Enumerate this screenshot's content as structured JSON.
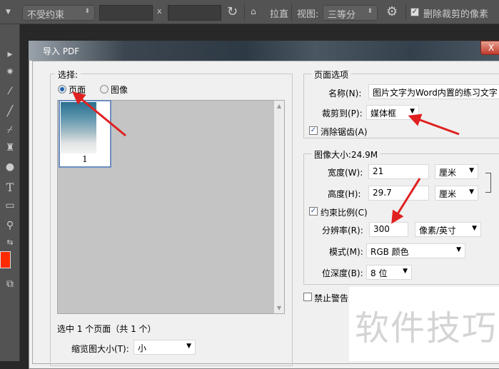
{
  "toolbar": {
    "constraint": "不受约束",
    "x_sep": "x",
    "straighten": "拉直",
    "view_label": "视图:",
    "view_value": "三等分",
    "delete_cropped": "删除裁剪的像素",
    "delete_cropped_checked": true
  },
  "dialog": {
    "title": "导入 PDF",
    "close": "X",
    "select_group": {
      "label": "选择:",
      "radio_page": "页面",
      "radio_image": "图像",
      "selected": "页面",
      "thumbnail_page_num": "1",
      "status": "选中 1 个页面（共 1 个）",
      "thumb_size_label": "缩览图大小(T):",
      "thumb_size_value": "小"
    },
    "page_options": {
      "label": "页面选项",
      "name_label": "名称(N):",
      "name_value": "图片文字为Word内置的练习文字",
      "crop_label": "裁剪到(P):",
      "crop_value": "媒体框",
      "anti_alias": "消除锯齿(A)",
      "anti_alias_checked": true
    },
    "image_size": {
      "label": "图像大小:24.9M",
      "width_label": "宽度(W):",
      "width_value": "21",
      "width_unit": "厘米",
      "height_label": "高度(H):",
      "height_value": "29.7",
      "height_unit": "厘米",
      "constrain": "约束比例(C)",
      "constrain_checked": true,
      "resolution_label": "分辨率(R):",
      "resolution_value": "300",
      "resolution_unit": "像素/英寸",
      "mode_label": "模式(M):",
      "mode_value": "RGB 颜色",
      "depth_label": "位深度(B):",
      "depth_value": "8 位"
    },
    "suppress_warnings": "禁止警告",
    "suppress_checked": false
  },
  "watermark": "软件技巧",
  "colors": {
    "foreground": "#ff2a00",
    "arrow": "#e02020"
  }
}
